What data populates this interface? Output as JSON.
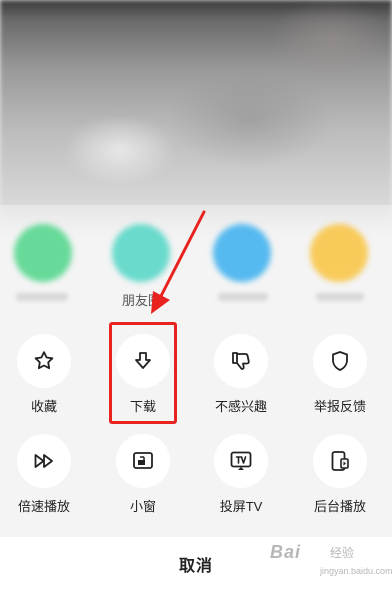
{
  "share": {
    "moments_label_fragment": "朋友圈"
  },
  "actions_row1": [
    {
      "label": "收藏",
      "icon": "star-icon"
    },
    {
      "label": "下载",
      "icon": "download-icon"
    },
    {
      "label": "不感兴趣",
      "icon": "thumbs-down-icon"
    },
    {
      "label": "举报反馈",
      "icon": "shield-icon"
    }
  ],
  "actions_row2": [
    {
      "label": "倍速播放",
      "icon": "fast-forward-icon"
    },
    {
      "label": "小窗",
      "icon": "picture-in-picture-icon"
    },
    {
      "label": "投屏TV",
      "icon": "tv-cast-icon"
    },
    {
      "label": "后台播放",
      "icon": "background-play-icon"
    }
  ],
  "cancel_label": "取消",
  "watermark": {
    "main": "Bai",
    "sub": "经验",
    "url": "jingyan.baidu.com"
  },
  "colors": {
    "annotation_red": "#e8231f",
    "sheet_bg": "#f4f4f4"
  }
}
